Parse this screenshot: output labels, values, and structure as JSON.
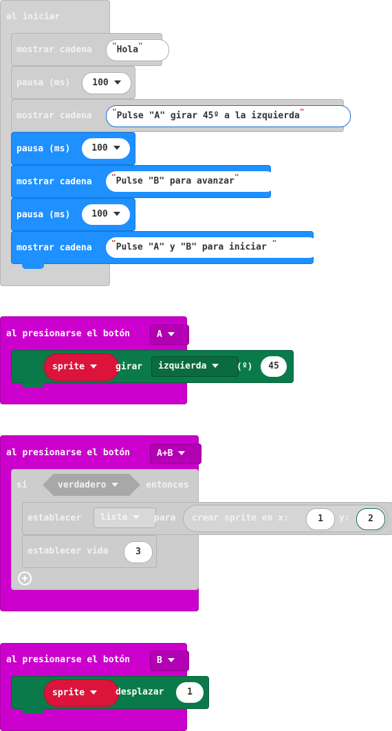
{
  "start": {
    "header": "al iniciar",
    "blocks": [
      {
        "kind": "show-string",
        "label": "mostrar cadena",
        "value": "Hola"
      },
      {
        "kind": "pause",
        "label": "pausa (ms)",
        "value": "100"
      },
      {
        "kind": "show-string",
        "label": "mostrar cadena",
        "value": "Pulse \"A\" girar 45º a la izquierda"
      },
      {
        "kind": "pause",
        "label": "pausa (ms)",
        "value": "100"
      },
      {
        "kind": "show-string",
        "label": "mostrar cadena",
        "value": "Pulse \"B\" para avanzar"
      },
      {
        "kind": "pause",
        "label": "pausa (ms)",
        "value": "100"
      },
      {
        "kind": "show-string",
        "label": "mostrar cadena",
        "value": "Pulse \"A\" y \"B\" para iniciar "
      }
    ]
  },
  "buttonA": {
    "header": "al presionarse el botón",
    "button": "A",
    "sprite": "sprite",
    "turn": "girar",
    "direction": "izquierda",
    "degrees_label": "(º)",
    "degrees": "45"
  },
  "buttonAB": {
    "header": "al presionarse el botón",
    "button": "A+B",
    "if_label": "si",
    "condition": "verdadero",
    "then_label": "entonces",
    "set_label": "establecer",
    "variable": "lista",
    "to_label": "para",
    "create_label": "crear sprite en x:",
    "x": "1",
    "y_label": "y:",
    "y": "2",
    "life_label": "establecer vida",
    "life": "3"
  },
  "buttonB": {
    "header": "al presionarse el botón",
    "button": "B",
    "sprite": "sprite",
    "move": "desplazar",
    "steps": "1"
  },
  "colors": {
    "disabled": "#cfcfcf",
    "basic": "#1e90ff",
    "input": "#cc00cc",
    "game": "#0b7a4a",
    "variable": "#dc143c"
  }
}
